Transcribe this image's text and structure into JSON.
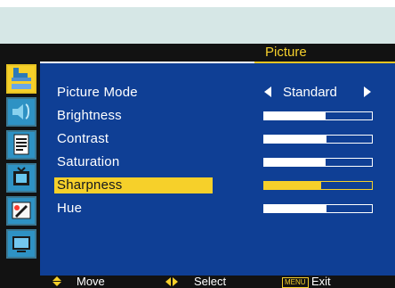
{
  "menu": {
    "title": "Picture",
    "sidebar_icons": [
      {
        "name": "picture-settings-icon",
        "active": true
      },
      {
        "name": "audio-icon",
        "active": false
      },
      {
        "name": "document-icon",
        "active": false
      },
      {
        "name": "tv-icon",
        "active": false
      },
      {
        "name": "color-palette-icon",
        "active": false
      },
      {
        "name": "monitor-icon",
        "active": false
      }
    ],
    "rows": [
      {
        "label": "Picture Mode",
        "type": "selector",
        "value": "Standard",
        "selected": false
      },
      {
        "label": "Brightness",
        "type": "bar",
        "level": 0.57,
        "selected": false
      },
      {
        "label": "Contrast",
        "type": "bar",
        "level": 0.58,
        "selected": false
      },
      {
        "label": "Saturation",
        "type": "bar",
        "level": 0.57,
        "selected": false
      },
      {
        "label": "Sharpness",
        "type": "bar",
        "level": 0.53,
        "selected": true
      },
      {
        "label": "Hue",
        "type": "bar",
        "level": 0.58,
        "selected": false
      }
    ]
  },
  "footer": {
    "move_label": "Move",
    "select_label": "Select",
    "menu_badge": "MENU",
    "exit_label": "Exit"
  },
  "colors": {
    "panel": "#0f3f95",
    "accent": "#f6d02a",
    "bar_chrome": "#121212",
    "top_band": "#d6e7e6"
  }
}
